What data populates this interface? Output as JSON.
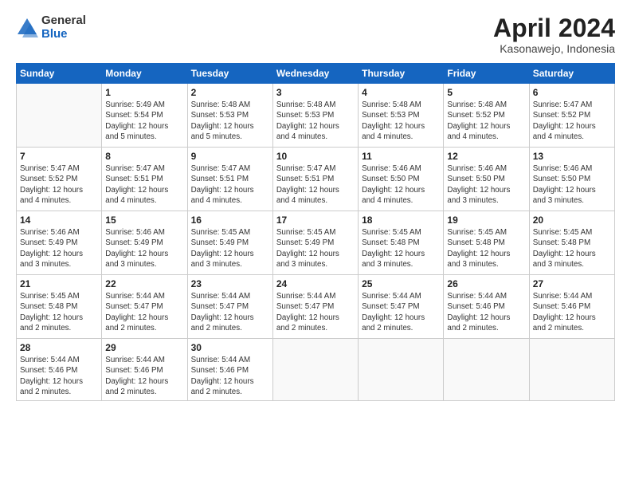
{
  "logo": {
    "general": "General",
    "blue": "Blue"
  },
  "title": "April 2024",
  "subtitle": "Kasonawejo, Indonesia",
  "days_header": [
    "Sunday",
    "Monday",
    "Tuesday",
    "Wednesday",
    "Thursday",
    "Friday",
    "Saturday"
  ],
  "weeks": [
    [
      {
        "num": "",
        "info": ""
      },
      {
        "num": "1",
        "info": "Sunrise: 5:49 AM\nSunset: 5:54 PM\nDaylight: 12 hours\nand 5 minutes."
      },
      {
        "num": "2",
        "info": "Sunrise: 5:48 AM\nSunset: 5:53 PM\nDaylight: 12 hours\nand 5 minutes."
      },
      {
        "num": "3",
        "info": "Sunrise: 5:48 AM\nSunset: 5:53 PM\nDaylight: 12 hours\nand 4 minutes."
      },
      {
        "num": "4",
        "info": "Sunrise: 5:48 AM\nSunset: 5:53 PM\nDaylight: 12 hours\nand 4 minutes."
      },
      {
        "num": "5",
        "info": "Sunrise: 5:48 AM\nSunset: 5:52 PM\nDaylight: 12 hours\nand 4 minutes."
      },
      {
        "num": "6",
        "info": "Sunrise: 5:47 AM\nSunset: 5:52 PM\nDaylight: 12 hours\nand 4 minutes."
      }
    ],
    [
      {
        "num": "7",
        "info": "Sunrise: 5:47 AM\nSunset: 5:52 PM\nDaylight: 12 hours\nand 4 minutes."
      },
      {
        "num": "8",
        "info": "Sunrise: 5:47 AM\nSunset: 5:51 PM\nDaylight: 12 hours\nand 4 minutes."
      },
      {
        "num": "9",
        "info": "Sunrise: 5:47 AM\nSunset: 5:51 PM\nDaylight: 12 hours\nand 4 minutes."
      },
      {
        "num": "10",
        "info": "Sunrise: 5:47 AM\nSunset: 5:51 PM\nDaylight: 12 hours\nand 4 minutes."
      },
      {
        "num": "11",
        "info": "Sunrise: 5:46 AM\nSunset: 5:50 PM\nDaylight: 12 hours\nand 4 minutes."
      },
      {
        "num": "12",
        "info": "Sunrise: 5:46 AM\nSunset: 5:50 PM\nDaylight: 12 hours\nand 3 minutes."
      },
      {
        "num": "13",
        "info": "Sunrise: 5:46 AM\nSunset: 5:50 PM\nDaylight: 12 hours\nand 3 minutes."
      }
    ],
    [
      {
        "num": "14",
        "info": "Sunrise: 5:46 AM\nSunset: 5:49 PM\nDaylight: 12 hours\nand 3 minutes."
      },
      {
        "num": "15",
        "info": "Sunrise: 5:46 AM\nSunset: 5:49 PM\nDaylight: 12 hours\nand 3 minutes."
      },
      {
        "num": "16",
        "info": "Sunrise: 5:45 AM\nSunset: 5:49 PM\nDaylight: 12 hours\nand 3 minutes."
      },
      {
        "num": "17",
        "info": "Sunrise: 5:45 AM\nSunset: 5:49 PM\nDaylight: 12 hours\nand 3 minutes."
      },
      {
        "num": "18",
        "info": "Sunrise: 5:45 AM\nSunset: 5:48 PM\nDaylight: 12 hours\nand 3 minutes."
      },
      {
        "num": "19",
        "info": "Sunrise: 5:45 AM\nSunset: 5:48 PM\nDaylight: 12 hours\nand 3 minutes."
      },
      {
        "num": "20",
        "info": "Sunrise: 5:45 AM\nSunset: 5:48 PM\nDaylight: 12 hours\nand 3 minutes."
      }
    ],
    [
      {
        "num": "21",
        "info": "Sunrise: 5:45 AM\nSunset: 5:48 PM\nDaylight: 12 hours\nand 2 minutes."
      },
      {
        "num": "22",
        "info": "Sunrise: 5:44 AM\nSunset: 5:47 PM\nDaylight: 12 hours\nand 2 minutes."
      },
      {
        "num": "23",
        "info": "Sunrise: 5:44 AM\nSunset: 5:47 PM\nDaylight: 12 hours\nand 2 minutes."
      },
      {
        "num": "24",
        "info": "Sunrise: 5:44 AM\nSunset: 5:47 PM\nDaylight: 12 hours\nand 2 minutes."
      },
      {
        "num": "25",
        "info": "Sunrise: 5:44 AM\nSunset: 5:47 PM\nDaylight: 12 hours\nand 2 minutes."
      },
      {
        "num": "26",
        "info": "Sunrise: 5:44 AM\nSunset: 5:46 PM\nDaylight: 12 hours\nand 2 minutes."
      },
      {
        "num": "27",
        "info": "Sunrise: 5:44 AM\nSunset: 5:46 PM\nDaylight: 12 hours\nand 2 minutes."
      }
    ],
    [
      {
        "num": "28",
        "info": "Sunrise: 5:44 AM\nSunset: 5:46 PM\nDaylight: 12 hours\nand 2 minutes."
      },
      {
        "num": "29",
        "info": "Sunrise: 5:44 AM\nSunset: 5:46 PM\nDaylight: 12 hours\nand 2 minutes."
      },
      {
        "num": "30",
        "info": "Sunrise: 5:44 AM\nSunset: 5:46 PM\nDaylight: 12 hours\nand 2 minutes."
      },
      {
        "num": "",
        "info": ""
      },
      {
        "num": "",
        "info": ""
      },
      {
        "num": "",
        "info": ""
      },
      {
        "num": "",
        "info": ""
      }
    ]
  ]
}
